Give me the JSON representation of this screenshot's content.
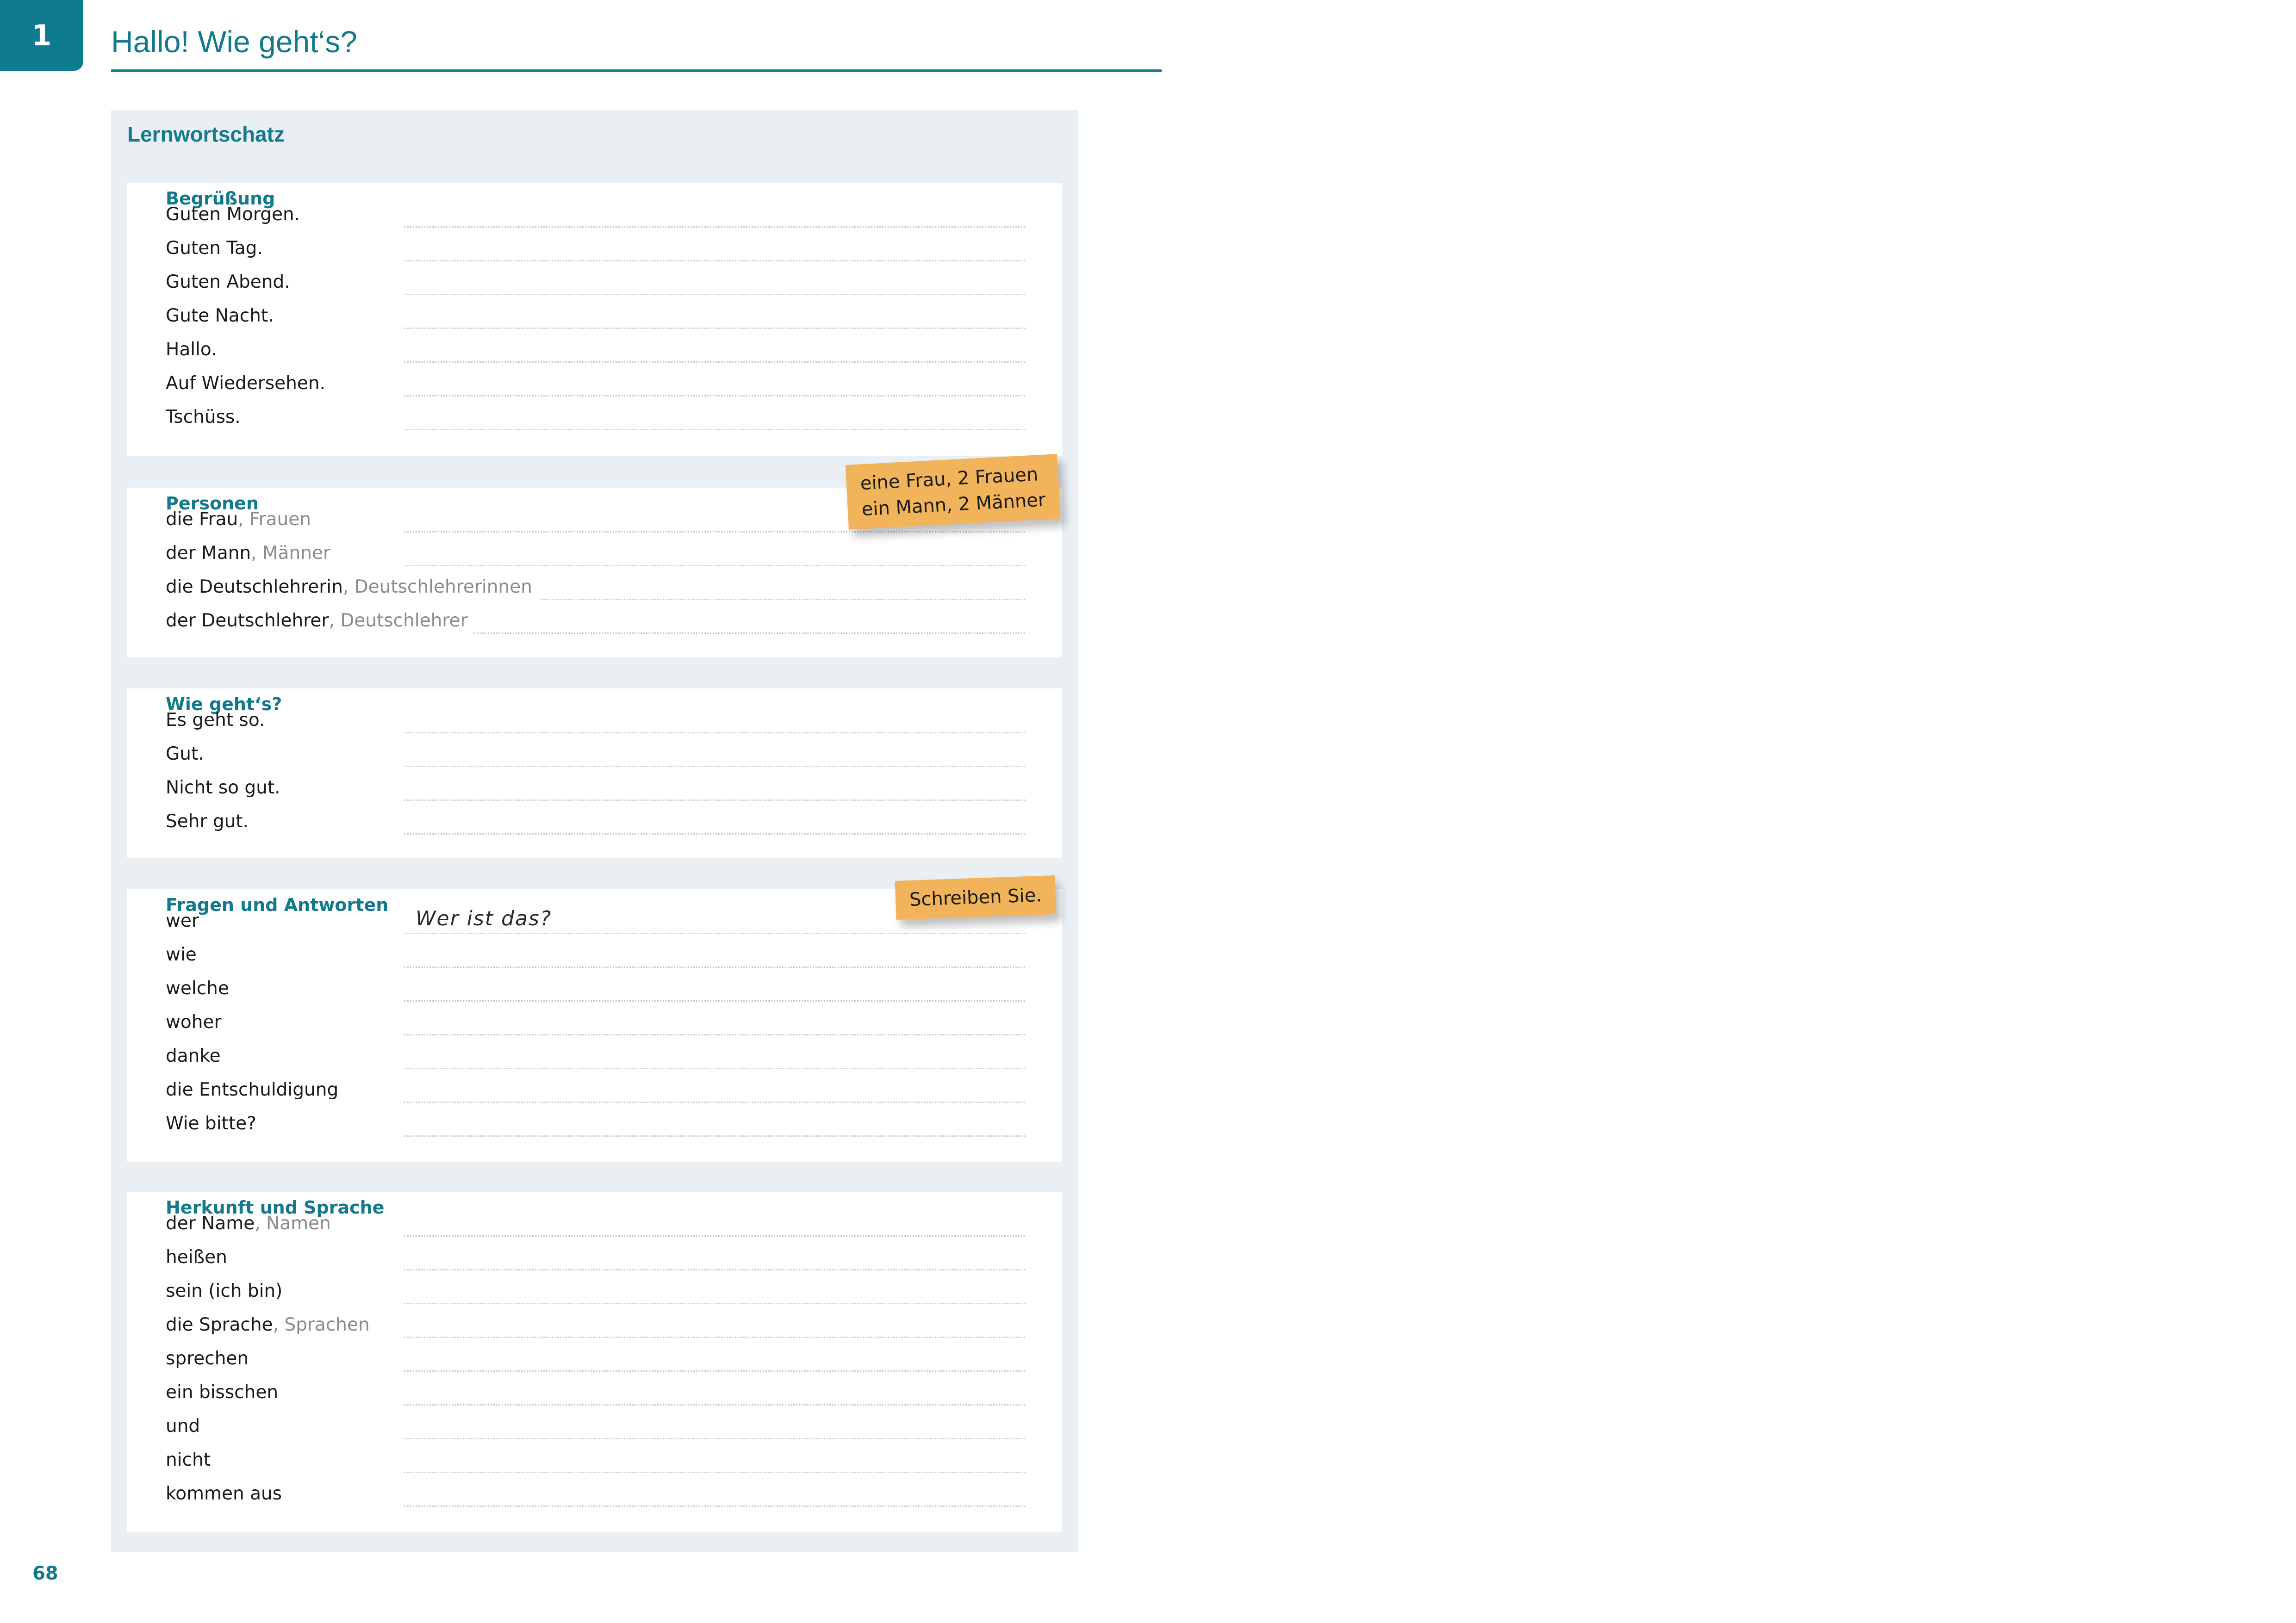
{
  "chapter": {
    "number": "1",
    "title": "Hallo! Wie geht‘s?"
  },
  "panel_title": "Lernwortschatz",
  "sections": [
    {
      "title": "Begrüßung",
      "items": [
        {
          "word": "Guten Morgen.",
          "plural": ""
        },
        {
          "word": "Guten Tag.",
          "plural": ""
        },
        {
          "word": "Guten Abend.",
          "plural": ""
        },
        {
          "word": "Gute Nacht.",
          "plural": ""
        },
        {
          "word": "Hallo.",
          "plural": ""
        },
        {
          "word": "Auf Wiedersehen.",
          "plural": ""
        },
        {
          "word": "Tschüss.",
          "plural": ""
        }
      ]
    },
    {
      "title": "Personen",
      "items": [
        {
          "word": "die Frau",
          "plural": ", Frauen"
        },
        {
          "word": "der Mann",
          "plural": ", Männer"
        },
        {
          "word": "die Deutschlehrerin",
          "plural": ", Deutschlehrerinnen"
        },
        {
          "word": "der Deutschlehrer",
          "plural": ", Deutschlehrer"
        }
      ]
    },
    {
      "title": "Wie geht‘s?",
      "items": [
        {
          "word": "Es geht so.",
          "plural": ""
        },
        {
          "word": "Gut.",
          "plural": ""
        },
        {
          "word": "Nicht so gut.",
          "plural": ""
        },
        {
          "word": "Sehr gut.",
          "plural": ""
        }
      ]
    },
    {
      "title": "Fragen und Antworten",
      "items": [
        {
          "word": "wer",
          "plural": "",
          "answer": "Wer ist das?"
        },
        {
          "word": "wie",
          "plural": ""
        },
        {
          "word": "welche",
          "plural": ""
        },
        {
          "word": "woher",
          "plural": ""
        },
        {
          "word": "danke",
          "plural": ""
        },
        {
          "word": "die Entschuldigung",
          "plural": ""
        },
        {
          "word": "Wie bitte?",
          "plural": ""
        }
      ]
    },
    {
      "title": "Herkunft und Sprache",
      "items": [
        {
          "word": "der Name",
          "plural": ", Namen"
        },
        {
          "word": "heißen",
          "plural": ""
        },
        {
          "word": "sein (ich bin)",
          "plural": ""
        },
        {
          "word": "die Sprache",
          "plural": ", Sprachen"
        },
        {
          "word": "sprechen",
          "plural": ""
        },
        {
          "word": "ein bisschen",
          "plural": ""
        },
        {
          "word": "und",
          "plural": ""
        },
        {
          "word": "nicht",
          "plural": ""
        },
        {
          "word": "kommen aus",
          "plural": ""
        }
      ]
    }
  ],
  "notes": {
    "plural_hint": {
      "line1": "eine Frau, 2 Frauen",
      "line2": "ein Mann, 2 Männer",
      "color": "#f2b45a"
    },
    "write_hint": {
      "text": "Schreiben Sie.",
      "color": "#f2b45a"
    }
  },
  "accent_color": "#137a8c",
  "page_number": "68"
}
